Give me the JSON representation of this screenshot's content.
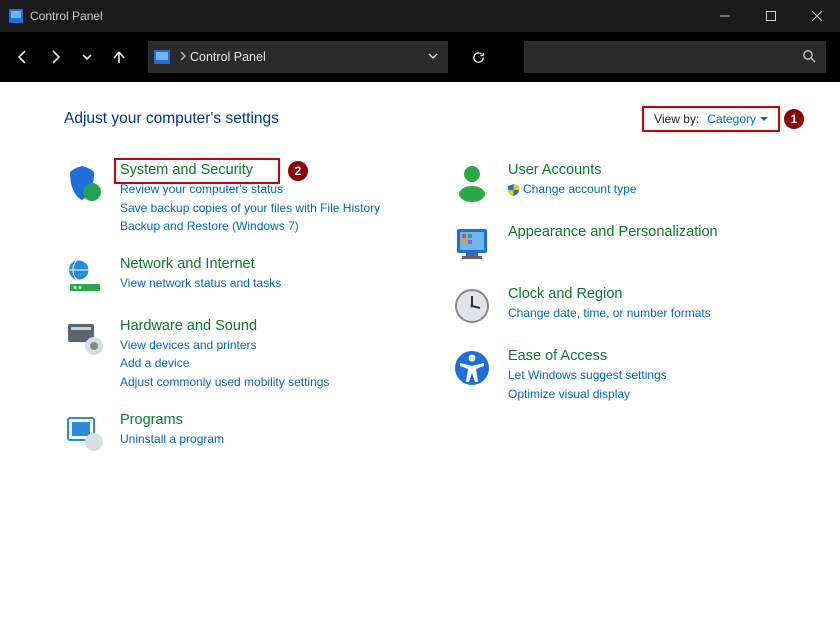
{
  "window": {
    "title": "Control Panel"
  },
  "address": {
    "crumb": "Control Panel"
  },
  "header": {
    "title": "Adjust your computer's settings",
    "view_by_label": "View by:",
    "view_by_value": "Category"
  },
  "annotations": {
    "one": "1",
    "two": "2"
  },
  "left": [
    {
      "title": "System and Security",
      "links": [
        "Review your computer's status",
        "Save backup copies of your files with File History",
        "Backup and Restore (Windows 7)"
      ]
    },
    {
      "title": "Network and Internet",
      "links": [
        "View network status and tasks"
      ]
    },
    {
      "title": "Hardware and Sound",
      "links": [
        "View devices and printers",
        "Add a device",
        "Adjust commonly used mobility settings"
      ]
    },
    {
      "title": "Programs",
      "links": [
        "Uninstall a program"
      ]
    }
  ],
  "right": [
    {
      "title": "User Accounts",
      "links": [
        "Change account type"
      ],
      "shield": true
    },
    {
      "title": "Appearance and Personalization",
      "links": []
    },
    {
      "title": "Clock and Region",
      "links": [
        "Change date, time, or number formats"
      ]
    },
    {
      "title": "Ease of Access",
      "links": [
        "Let Windows suggest settings",
        "Optimize visual display"
      ]
    }
  ]
}
